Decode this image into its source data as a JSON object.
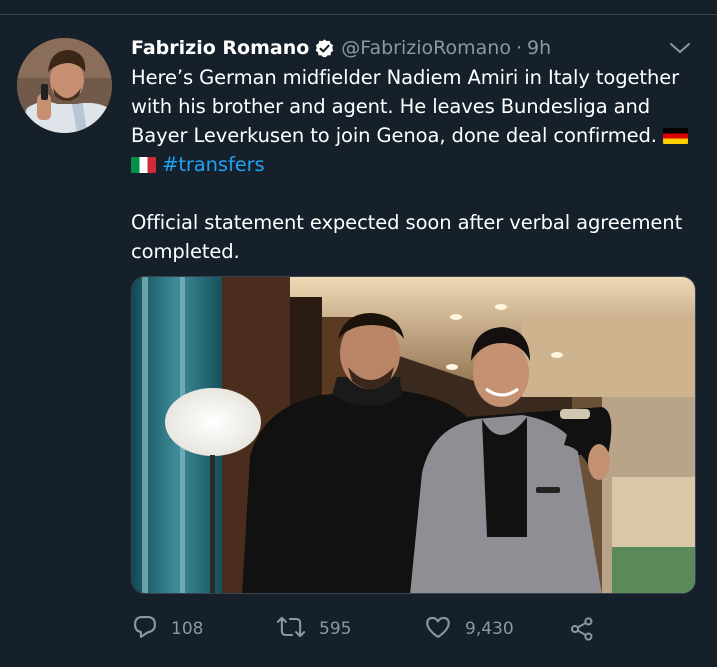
{
  "tweet": {
    "author_name": "Fabrizio Romano",
    "handle": "@FabrizioRomano",
    "separator": "·",
    "time": "9h",
    "text_line1": "Here’s German midfielder Nadiem Amiri in Italy together with his brother and agent. He leaves Bundesliga and Bayer Leverkusen to join Genoa, done deal confirmed.",
    "hashtag": "#transfers",
    "text_para2": "Official statement expected soon after verbal agreement completed."
  },
  "actions": {
    "replies": "108",
    "retweets": "595",
    "likes": "9,430"
  },
  "icons": {
    "verified": "verified-badge-icon",
    "menu": "chevron-down-icon",
    "reply": "reply-icon",
    "retweet": "retweet-icon",
    "like": "heart-icon",
    "share": "share-icon"
  },
  "colors": {
    "background": "#15202b",
    "secondary_text": "#8899a6",
    "link": "#1da1f2",
    "divider": "#38444d"
  }
}
